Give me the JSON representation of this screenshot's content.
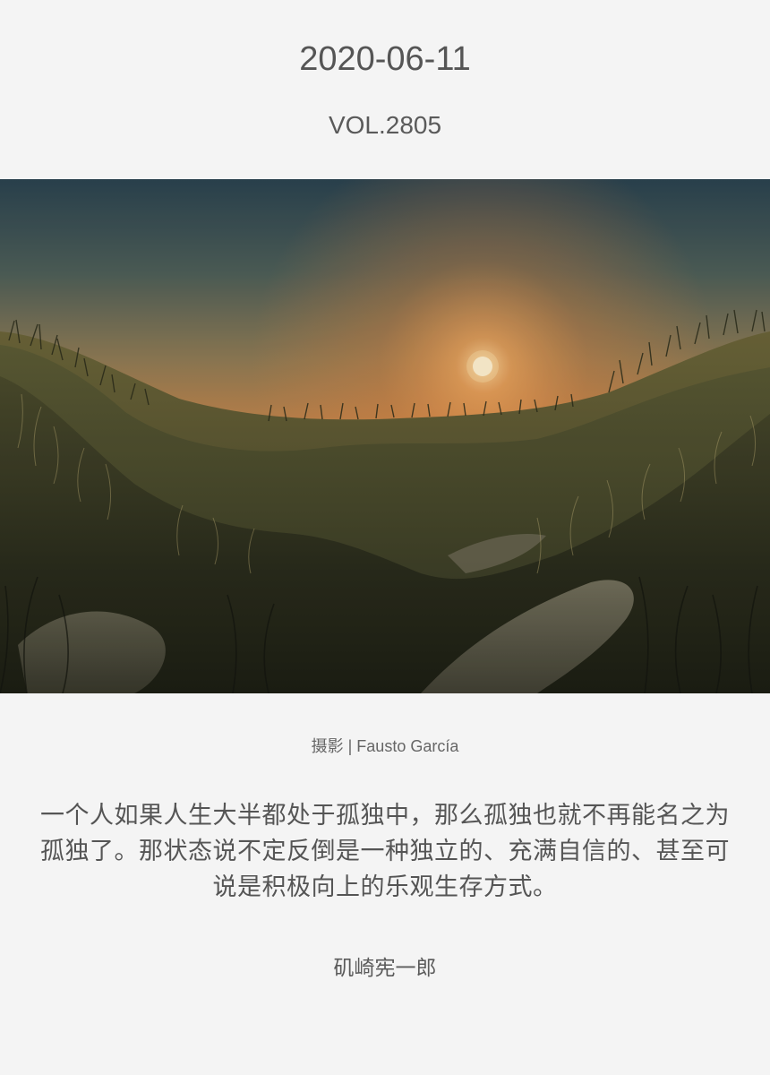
{
  "header": {
    "date": "2020-06-11",
    "volume": "VOL.2805"
  },
  "photo": {
    "subject": "sunset over grassy sand dunes",
    "credit": "摄影 | Fausto García"
  },
  "quote": {
    "text": "一个人如果人生大半都处于孤独中，那么孤独也就不再能名之为孤独了。那状态说不定反倒是一种独立的、充满自信的、甚至可说是积极向上的乐观生存方式。",
    "author": "矶崎宪一郎"
  },
  "colors": {
    "background": "#f4f4f4",
    "text": "#555555",
    "sky_top": "#2f4a55",
    "sky_glow": "#e0803a",
    "sun": "#fff6d8"
  }
}
